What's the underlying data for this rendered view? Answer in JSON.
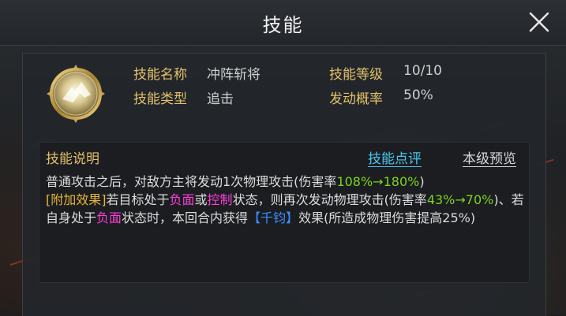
{
  "window": {
    "title": "技能",
    "close_icon": "close-x-icon"
  },
  "skill": {
    "icon": "golden-orb-skill-icon",
    "name_label": "技能名称",
    "name_value": "冲阵斩将",
    "type_label": "技能类型",
    "type_value": "追击",
    "level_label": "技能等级",
    "level_value": "10/10",
    "trigger_label": "发动概率",
    "trigger_value": "50%"
  },
  "description": {
    "header": "技能说明",
    "review_link": "技能点评",
    "preview_link": "本级预览",
    "line1_pre": "普通攻击之后，对敌方主将发动1次物理攻击(伤害率",
    "line1_val": "108%→180%",
    "line1_post": ")",
    "extra_tag": "[附加效果]",
    "seg_target": "若目标处于",
    "neg1": "负面",
    "seg_or": "或",
    "ctrl": "控制",
    "seg_state": "状态，则再次发动物理攻击(伤害率",
    "val2": "43%→70%",
    "seg_self": ")、若自身处于",
    "neg2": "负面",
    "seg_gain": "状态时，本回合内获得",
    "buff": "【千钧】",
    "seg_end": "效果(所造成物理伤害提高25%)"
  },
  "colors": {
    "label_gold": "#e3c06b",
    "link_cyan": "#49c6ee",
    "value_green": "#7ed321",
    "tag_yellow": "#e7b63a",
    "status_magenta": "#ff3dd8",
    "buff_blue": "#3d8cff"
  }
}
